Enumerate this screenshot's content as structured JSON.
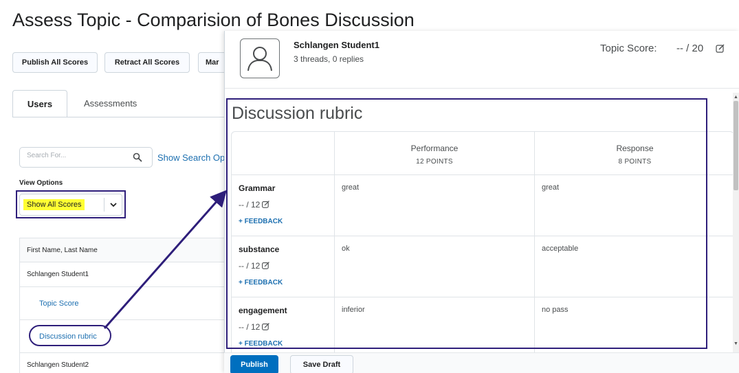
{
  "page": {
    "title": "Assess Topic - Comparision of Bones Discussion"
  },
  "toolbar": {
    "publish_all": "Publish All Scores",
    "retract_all": "Retract All Scores",
    "mark_partial": "Mar"
  },
  "tabs": {
    "users": "Users",
    "assessments": "Assessments"
  },
  "search": {
    "placeholder": "Search For...",
    "show_options": "Show Search Op"
  },
  "view_options": {
    "label": "View Options",
    "selected": "Show All Scores"
  },
  "users_table": {
    "header": "First Name, Last Name",
    "rows": {
      "student1": "Schlangen Student1",
      "topic_score": "Topic Score",
      "discussion_rubric": "Discussion rubric",
      "student2": "Schlangen Student2"
    }
  },
  "panel": {
    "student_name": "Schlangen Student1",
    "student_stats": "3 threads, 0 replies",
    "topic_score_label": "Topic Score:",
    "topic_score_value": "-- / 20"
  },
  "rubric": {
    "title": "Discussion rubric",
    "levels": [
      {
        "name": "Performance",
        "points": "12 POINTS"
      },
      {
        "name": "Response",
        "points": "8 POINTS"
      }
    ],
    "criteria": [
      {
        "name": "Grammar",
        "score": "-- / 12",
        "feedback": "+ FEEDBACK",
        "cells": [
          "great",
          "great"
        ]
      },
      {
        "name": "substance",
        "score": "-- / 12",
        "feedback": "+ FEEDBACK",
        "cells": [
          "ok",
          "acceptable"
        ]
      },
      {
        "name": "engagement",
        "score": "-- / 12",
        "feedback": "+ FEEDBACK",
        "cells": [
          "inferior",
          "no pass"
        ]
      }
    ]
  },
  "footer": {
    "publish": "Publish",
    "save_draft": "Save Draft"
  },
  "colors": {
    "link": "#1c6fb0",
    "primary_button": "#006fbf",
    "annotation": "#2e1e7a",
    "highlight": "#ffff33"
  }
}
